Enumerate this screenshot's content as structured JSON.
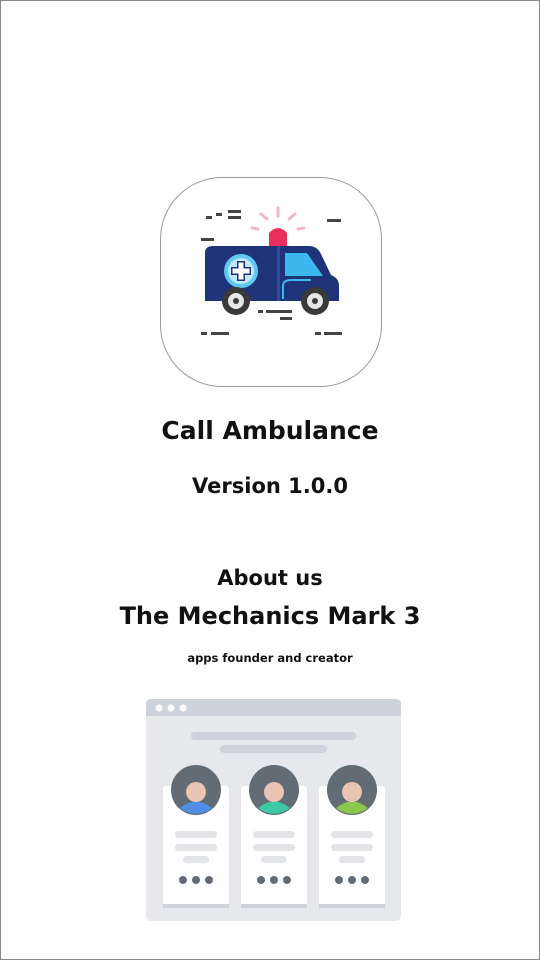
{
  "app": {
    "name": "Call Ambulance",
    "version": "Version 1.0.0",
    "icon": "ambulance-icon"
  },
  "about": {
    "heading": "About us",
    "company": "The Mechanics Mark 3",
    "tagline": "apps founder and creator",
    "illustration": "team-profiles-illustration"
  },
  "colors": {
    "ambulance_body": "#1f3378",
    "siren": "#e8305c",
    "window": "#3db8ee",
    "cross_badge": "#5ec8f0",
    "avatar_shirts": [
      "#4f8fe6",
      "#3cc9a3",
      "#8cc84b"
    ],
    "avatar_bg": "#636b75",
    "card_bg": "#e4e6ea"
  }
}
